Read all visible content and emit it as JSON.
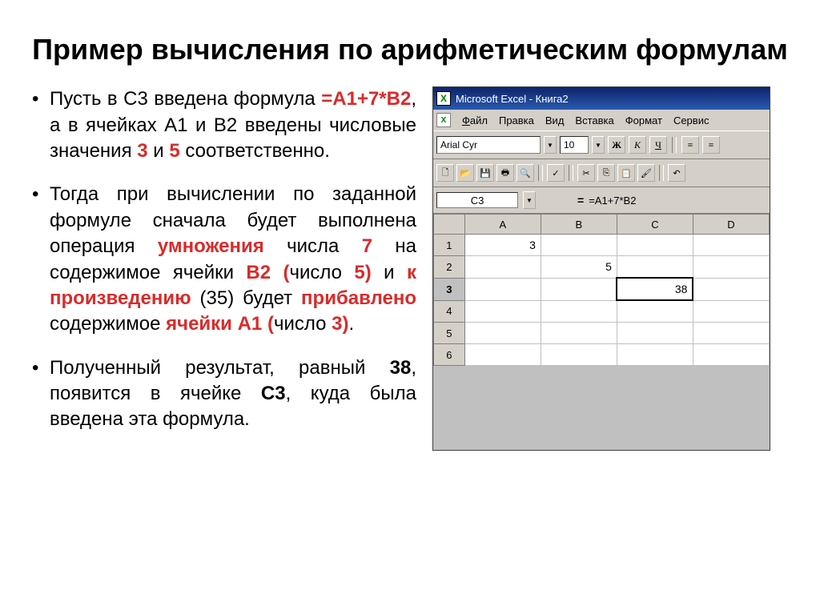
{
  "title": "Пример вычисления по арифметическим формулам",
  "bullets": {
    "b1": {
      "t1": "Пусть в С3 введена формула ",
      "formula": "=А1+7*В2",
      "t2": ", а в ячейках А1 и В2 введены числовые значения ",
      "v1": "3",
      "t3": " и ",
      "v2": "5",
      "t4": " соответственно."
    },
    "b2": {
      "t1": "Тогда при вычислении по заданной формуле сначала будет выполнена операция ",
      "op1": "умножения",
      "t2": " числа ",
      "n1": "7",
      "t3": " на содержимое ячейки ",
      "c1": "В2 (",
      "t4": "число ",
      "n2": "5",
      "c1b": ")",
      "t5": " и ",
      "op2": "к произведению",
      "t6": " (35) будет ",
      "op3": "прибавлено",
      "t7": " содержимое ",
      "c2": "ячейки А1 (",
      "t8": "число ",
      "n3": "3",
      "c2b": ")",
      "t9": "."
    },
    "b3": {
      "t1": "Полученный результат, равный ",
      "res": "38",
      "t2": ", появится в ячейке ",
      "cell": "С3",
      "t3": ", куда была введена эта формула."
    }
  },
  "excel": {
    "title": "Microsoft Excel - Книга2",
    "menu": {
      "file": "Файл",
      "edit": "Правка",
      "view": "Вид",
      "insert": "Вставка",
      "format": "Формат",
      "tools": "Сервис"
    },
    "font": "Arial Cyr",
    "fontsize": "10",
    "style": {
      "bold": "Ж",
      "italic": "К",
      "underline": "Ч"
    },
    "namebox": "C3",
    "formula": "=A1+7*B2",
    "cols": [
      "A",
      "B",
      "C",
      "D"
    ],
    "rows": [
      "1",
      "2",
      "3",
      "4",
      "5",
      "6"
    ],
    "cells": {
      "A1": "3",
      "B2": "5",
      "C3": "38"
    }
  }
}
